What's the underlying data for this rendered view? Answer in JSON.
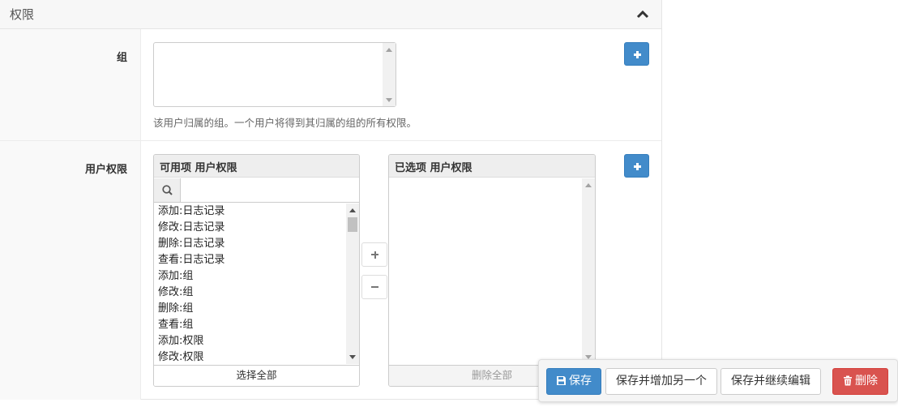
{
  "panel": {
    "title": "权限"
  },
  "groups": {
    "label": "组",
    "help": "该用户归属的组。一个用户将得到其归属的组的所有权限。"
  },
  "permissions": {
    "label": "用户权限",
    "available": {
      "title": "可用项 用户权限",
      "filter_placeholder": "",
      "options": [
        "添加:日志记录",
        "修改:日志记录",
        "删除:日志记录",
        "查看:日志记录",
        "添加:组",
        "修改:组",
        "删除:组",
        "查看:组",
        "添加:权限",
        "修改:权限"
      ],
      "choose_all": "选择全部"
    },
    "chosen": {
      "title": "已选项 用户权限",
      "remove_all": "删除全部"
    }
  },
  "actions": {
    "save": "保存",
    "save_add_another": "保存并增加另一个",
    "save_continue": "保存并继续编辑",
    "delete": "删除"
  },
  "colors": {
    "primary": "#428bca",
    "danger": "#d9534f"
  }
}
